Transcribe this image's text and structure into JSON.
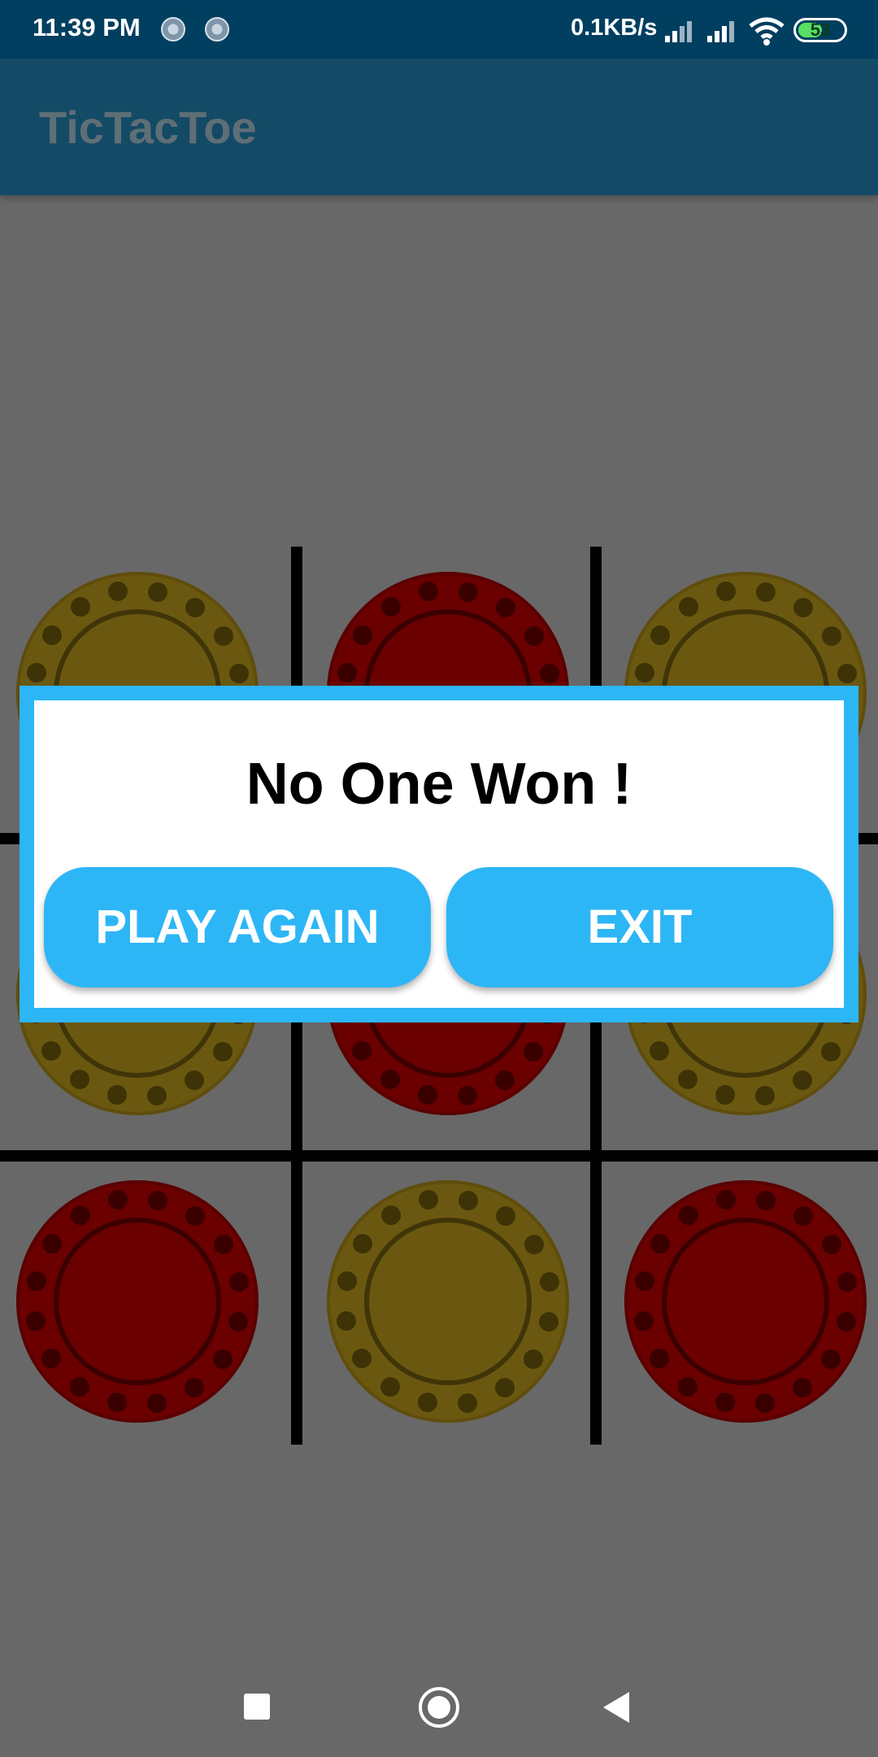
{
  "status_bar": {
    "time": "11:39 PM",
    "network_speed": "0.1KB/s",
    "battery_level": "53",
    "battery_fraction": 0.53,
    "icons": [
      "sync-icon",
      "sync-icon",
      "signal-icon",
      "signal-icon",
      "wifi-icon",
      "battery-icon"
    ]
  },
  "app_bar": {
    "title": "TicTacToe"
  },
  "board": {
    "cells": [
      "yellow",
      "red",
      "yellow",
      "yellow",
      "red",
      "yellow",
      "red",
      "yellow",
      "red"
    ]
  },
  "dialog": {
    "message": "No One Won !",
    "play_again_label": "PLAY AGAIN",
    "exit_label": "EXIT"
  },
  "nav_bar": {
    "icons": [
      "recent-apps-icon",
      "home-icon",
      "back-icon"
    ]
  },
  "colors": {
    "status_bar": "#013f60",
    "app_bar": "#134b66",
    "accent": "#2db6f6",
    "yellow_chip": "#6b5810",
    "red_chip": "#6a0000",
    "dim_background": "#686868"
  }
}
